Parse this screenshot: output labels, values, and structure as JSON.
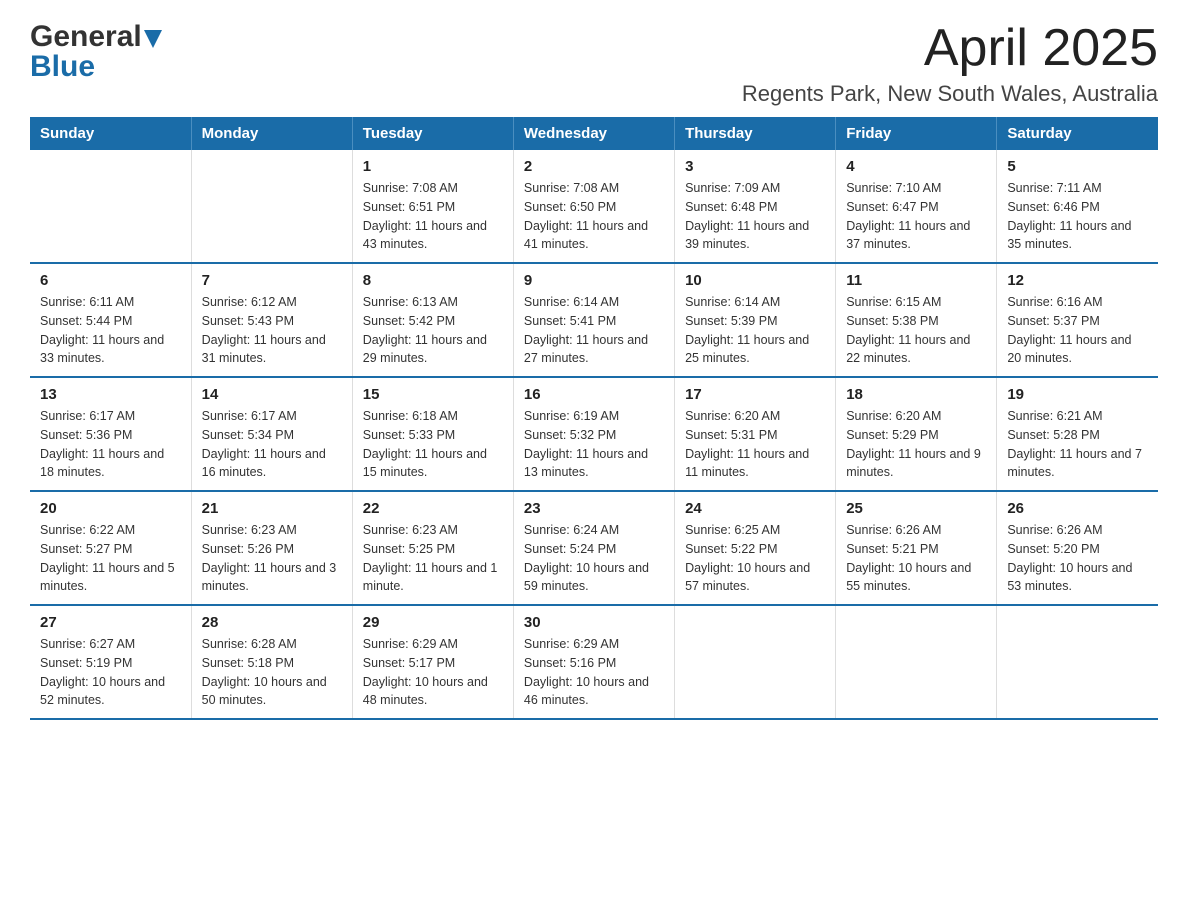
{
  "header": {
    "logo_general": "General",
    "logo_blue": "Blue",
    "title": "April 2025",
    "subtitle": "Regents Park, New South Wales, Australia"
  },
  "days_of_week": [
    "Sunday",
    "Monday",
    "Tuesday",
    "Wednesday",
    "Thursday",
    "Friday",
    "Saturday"
  ],
  "weeks": [
    [
      {
        "day": "",
        "sunrise": "",
        "sunset": "",
        "daylight": ""
      },
      {
        "day": "",
        "sunrise": "",
        "sunset": "",
        "daylight": ""
      },
      {
        "day": "1",
        "sunrise": "Sunrise: 7:08 AM",
        "sunset": "Sunset: 6:51 PM",
        "daylight": "Daylight: 11 hours and 43 minutes."
      },
      {
        "day": "2",
        "sunrise": "Sunrise: 7:08 AM",
        "sunset": "Sunset: 6:50 PM",
        "daylight": "Daylight: 11 hours and 41 minutes."
      },
      {
        "day": "3",
        "sunrise": "Sunrise: 7:09 AM",
        "sunset": "Sunset: 6:48 PM",
        "daylight": "Daylight: 11 hours and 39 minutes."
      },
      {
        "day": "4",
        "sunrise": "Sunrise: 7:10 AM",
        "sunset": "Sunset: 6:47 PM",
        "daylight": "Daylight: 11 hours and 37 minutes."
      },
      {
        "day": "5",
        "sunrise": "Sunrise: 7:11 AM",
        "sunset": "Sunset: 6:46 PM",
        "daylight": "Daylight: 11 hours and 35 minutes."
      }
    ],
    [
      {
        "day": "6",
        "sunrise": "Sunrise: 6:11 AM",
        "sunset": "Sunset: 5:44 PM",
        "daylight": "Daylight: 11 hours and 33 minutes."
      },
      {
        "day": "7",
        "sunrise": "Sunrise: 6:12 AM",
        "sunset": "Sunset: 5:43 PM",
        "daylight": "Daylight: 11 hours and 31 minutes."
      },
      {
        "day": "8",
        "sunrise": "Sunrise: 6:13 AM",
        "sunset": "Sunset: 5:42 PM",
        "daylight": "Daylight: 11 hours and 29 minutes."
      },
      {
        "day": "9",
        "sunrise": "Sunrise: 6:14 AM",
        "sunset": "Sunset: 5:41 PM",
        "daylight": "Daylight: 11 hours and 27 minutes."
      },
      {
        "day": "10",
        "sunrise": "Sunrise: 6:14 AM",
        "sunset": "Sunset: 5:39 PM",
        "daylight": "Daylight: 11 hours and 25 minutes."
      },
      {
        "day": "11",
        "sunrise": "Sunrise: 6:15 AM",
        "sunset": "Sunset: 5:38 PM",
        "daylight": "Daylight: 11 hours and 22 minutes."
      },
      {
        "day": "12",
        "sunrise": "Sunrise: 6:16 AM",
        "sunset": "Sunset: 5:37 PM",
        "daylight": "Daylight: 11 hours and 20 minutes."
      }
    ],
    [
      {
        "day": "13",
        "sunrise": "Sunrise: 6:17 AM",
        "sunset": "Sunset: 5:36 PM",
        "daylight": "Daylight: 11 hours and 18 minutes."
      },
      {
        "day": "14",
        "sunrise": "Sunrise: 6:17 AM",
        "sunset": "Sunset: 5:34 PM",
        "daylight": "Daylight: 11 hours and 16 minutes."
      },
      {
        "day": "15",
        "sunrise": "Sunrise: 6:18 AM",
        "sunset": "Sunset: 5:33 PM",
        "daylight": "Daylight: 11 hours and 15 minutes."
      },
      {
        "day": "16",
        "sunrise": "Sunrise: 6:19 AM",
        "sunset": "Sunset: 5:32 PM",
        "daylight": "Daylight: 11 hours and 13 minutes."
      },
      {
        "day": "17",
        "sunrise": "Sunrise: 6:20 AM",
        "sunset": "Sunset: 5:31 PM",
        "daylight": "Daylight: 11 hours and 11 minutes."
      },
      {
        "day": "18",
        "sunrise": "Sunrise: 6:20 AM",
        "sunset": "Sunset: 5:29 PM",
        "daylight": "Daylight: 11 hours and 9 minutes."
      },
      {
        "day": "19",
        "sunrise": "Sunrise: 6:21 AM",
        "sunset": "Sunset: 5:28 PM",
        "daylight": "Daylight: 11 hours and 7 minutes."
      }
    ],
    [
      {
        "day": "20",
        "sunrise": "Sunrise: 6:22 AM",
        "sunset": "Sunset: 5:27 PM",
        "daylight": "Daylight: 11 hours and 5 minutes."
      },
      {
        "day": "21",
        "sunrise": "Sunrise: 6:23 AM",
        "sunset": "Sunset: 5:26 PM",
        "daylight": "Daylight: 11 hours and 3 minutes."
      },
      {
        "day": "22",
        "sunrise": "Sunrise: 6:23 AM",
        "sunset": "Sunset: 5:25 PM",
        "daylight": "Daylight: 11 hours and 1 minute."
      },
      {
        "day": "23",
        "sunrise": "Sunrise: 6:24 AM",
        "sunset": "Sunset: 5:24 PM",
        "daylight": "Daylight: 10 hours and 59 minutes."
      },
      {
        "day": "24",
        "sunrise": "Sunrise: 6:25 AM",
        "sunset": "Sunset: 5:22 PM",
        "daylight": "Daylight: 10 hours and 57 minutes."
      },
      {
        "day": "25",
        "sunrise": "Sunrise: 6:26 AM",
        "sunset": "Sunset: 5:21 PM",
        "daylight": "Daylight: 10 hours and 55 minutes."
      },
      {
        "day": "26",
        "sunrise": "Sunrise: 6:26 AM",
        "sunset": "Sunset: 5:20 PM",
        "daylight": "Daylight: 10 hours and 53 minutes."
      }
    ],
    [
      {
        "day": "27",
        "sunrise": "Sunrise: 6:27 AM",
        "sunset": "Sunset: 5:19 PM",
        "daylight": "Daylight: 10 hours and 52 minutes."
      },
      {
        "day": "28",
        "sunrise": "Sunrise: 6:28 AM",
        "sunset": "Sunset: 5:18 PM",
        "daylight": "Daylight: 10 hours and 50 minutes."
      },
      {
        "day": "29",
        "sunrise": "Sunrise: 6:29 AM",
        "sunset": "Sunset: 5:17 PM",
        "daylight": "Daylight: 10 hours and 48 minutes."
      },
      {
        "day": "30",
        "sunrise": "Sunrise: 6:29 AM",
        "sunset": "Sunset: 5:16 PM",
        "daylight": "Daylight: 10 hours and 46 minutes."
      },
      {
        "day": "",
        "sunrise": "",
        "sunset": "",
        "daylight": ""
      },
      {
        "day": "",
        "sunrise": "",
        "sunset": "",
        "daylight": ""
      },
      {
        "day": "",
        "sunrise": "",
        "sunset": "",
        "daylight": ""
      }
    ]
  ]
}
